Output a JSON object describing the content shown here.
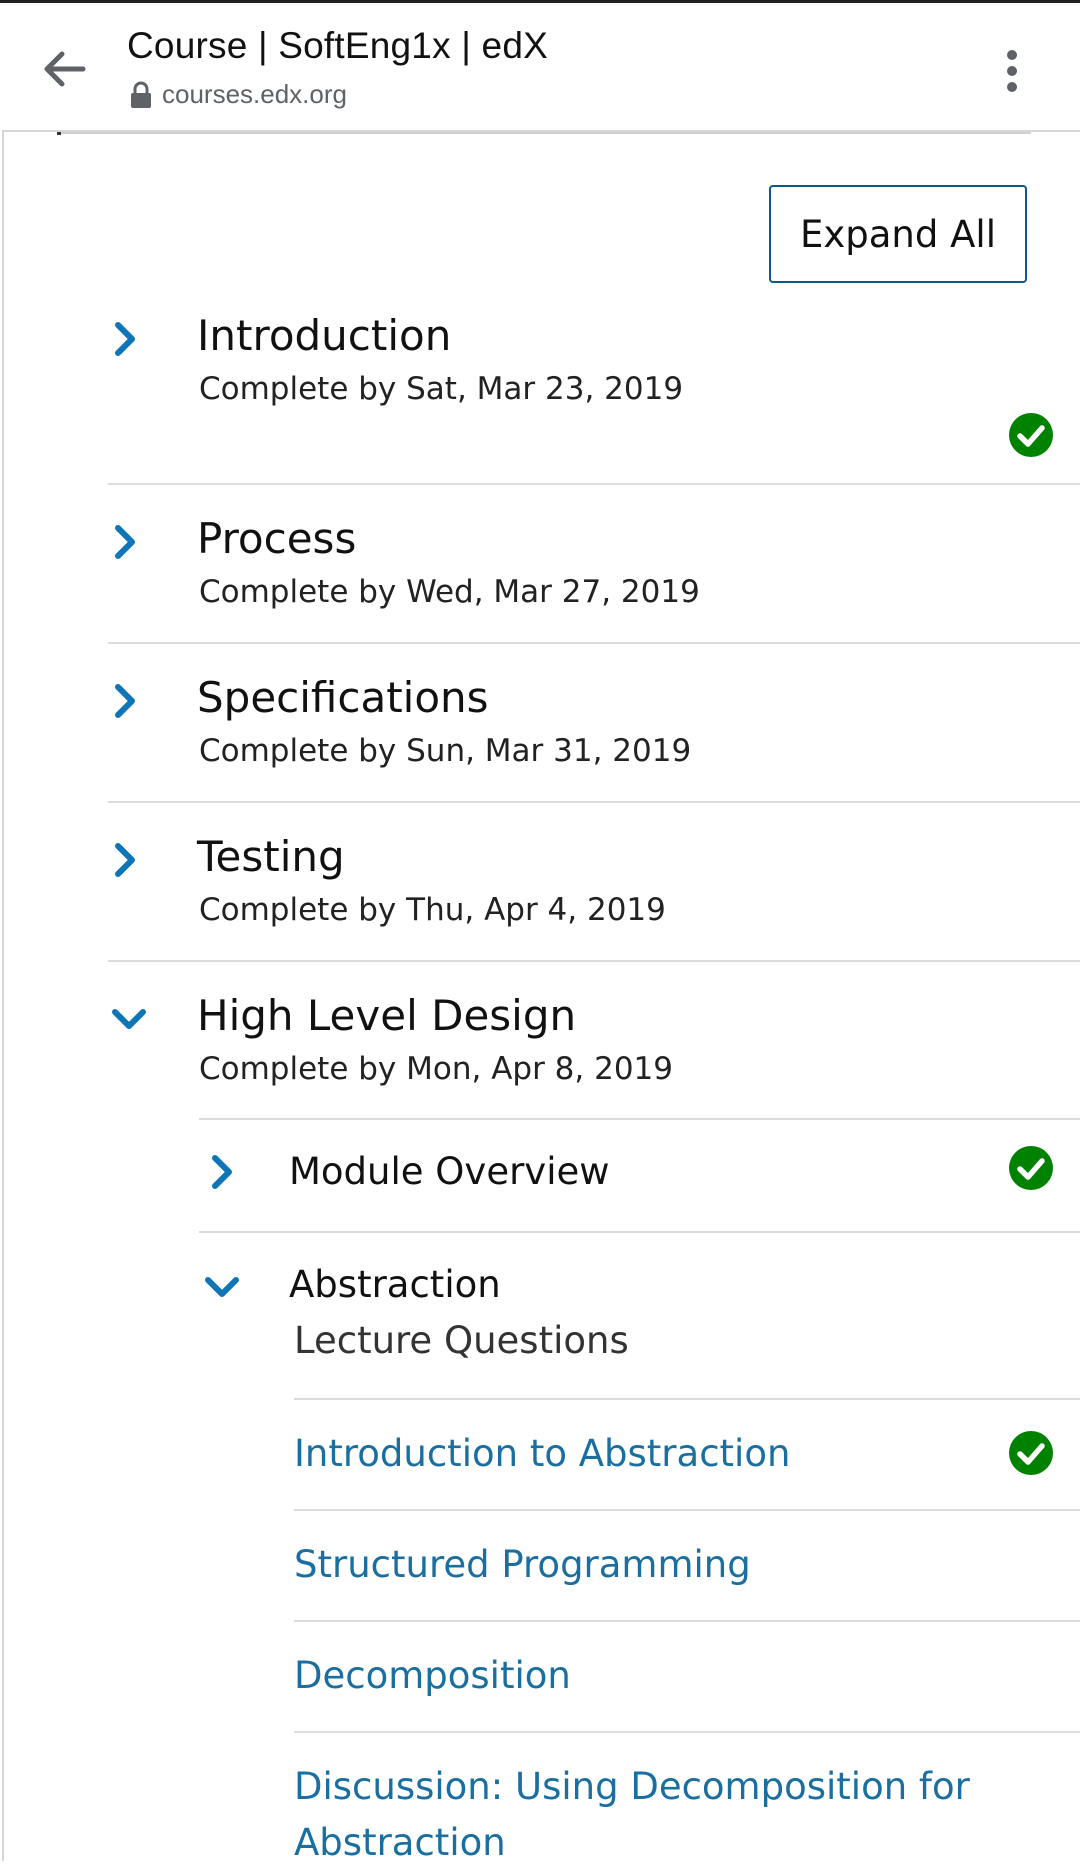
{
  "browser": {
    "title": "Course | SoftEng1x | edX",
    "url": "courses.edx.org"
  },
  "toolbar": {
    "expand_all_label": "Expand All"
  },
  "sections": [
    {
      "title": "Introduction",
      "due": "Complete by Sat, Mar 23, 2019",
      "completed": true,
      "expanded": false
    },
    {
      "title": "Process",
      "due": "Complete by Wed, Mar 27, 2019",
      "completed": false,
      "expanded": false
    },
    {
      "title": "Specifications",
      "due": "Complete by Sun, Mar 31, 2019",
      "completed": false,
      "expanded": false
    },
    {
      "title": "Testing",
      "due": "Complete by Thu, Apr 4, 2019",
      "completed": false,
      "expanded": false
    },
    {
      "title": "High Level Design",
      "due": "Complete by Mon, Apr 8, 2019",
      "completed": false,
      "expanded": true
    }
  ],
  "subsections": [
    {
      "title": "Module Overview",
      "expanded": false,
      "completed": true
    },
    {
      "title": "Abstraction",
      "caption": "Lecture Questions",
      "expanded": true,
      "completed": false
    }
  ],
  "units": [
    {
      "label": "Introduction to Abstraction",
      "completed": true
    },
    {
      "label": "Structured Programming",
      "completed": false
    },
    {
      "label": "Decomposition",
      "completed": false
    },
    {
      "label": "Discussion: Using Decomposition for Abstraction",
      "completed": false
    }
  ],
  "colors": {
    "accent": "#0e75b6",
    "link": "#1a6fa0",
    "success": "#008100"
  }
}
